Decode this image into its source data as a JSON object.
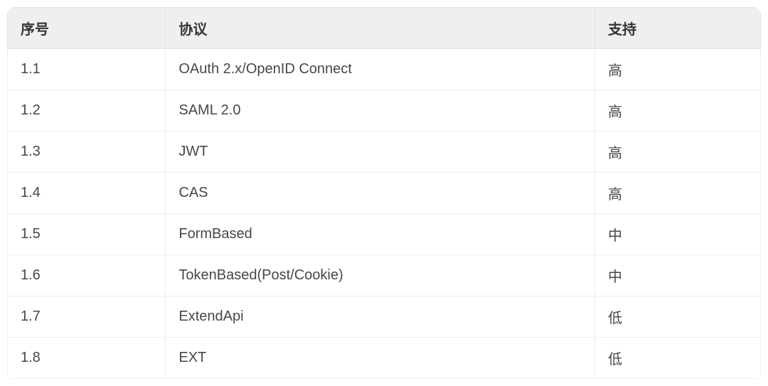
{
  "table": {
    "headers": {
      "col0": "序号",
      "col1": "协议",
      "col2": "支持"
    },
    "rows": [
      {
        "col0": "1.1",
        "col1": "OAuth 2.x/OpenID Connect",
        "col2": "高"
      },
      {
        "col0": "1.2",
        "col1": "SAML 2.0",
        "col2": "高"
      },
      {
        "col0": "1.3",
        "col1": "JWT",
        "col2": "高"
      },
      {
        "col0": "1.4",
        "col1": "CAS",
        "col2": "高"
      },
      {
        "col0": "1.5",
        "col1": "FormBased",
        "col2": "中"
      },
      {
        "col0": "1.6",
        "col1": "TokenBased(Post/Cookie)",
        "col2": "中"
      },
      {
        "col0": "1.7",
        "col1": "ExtendApi",
        "col2": "低"
      },
      {
        "col0": "1.8",
        "col1": "EXT",
        "col2": "低"
      }
    ]
  }
}
